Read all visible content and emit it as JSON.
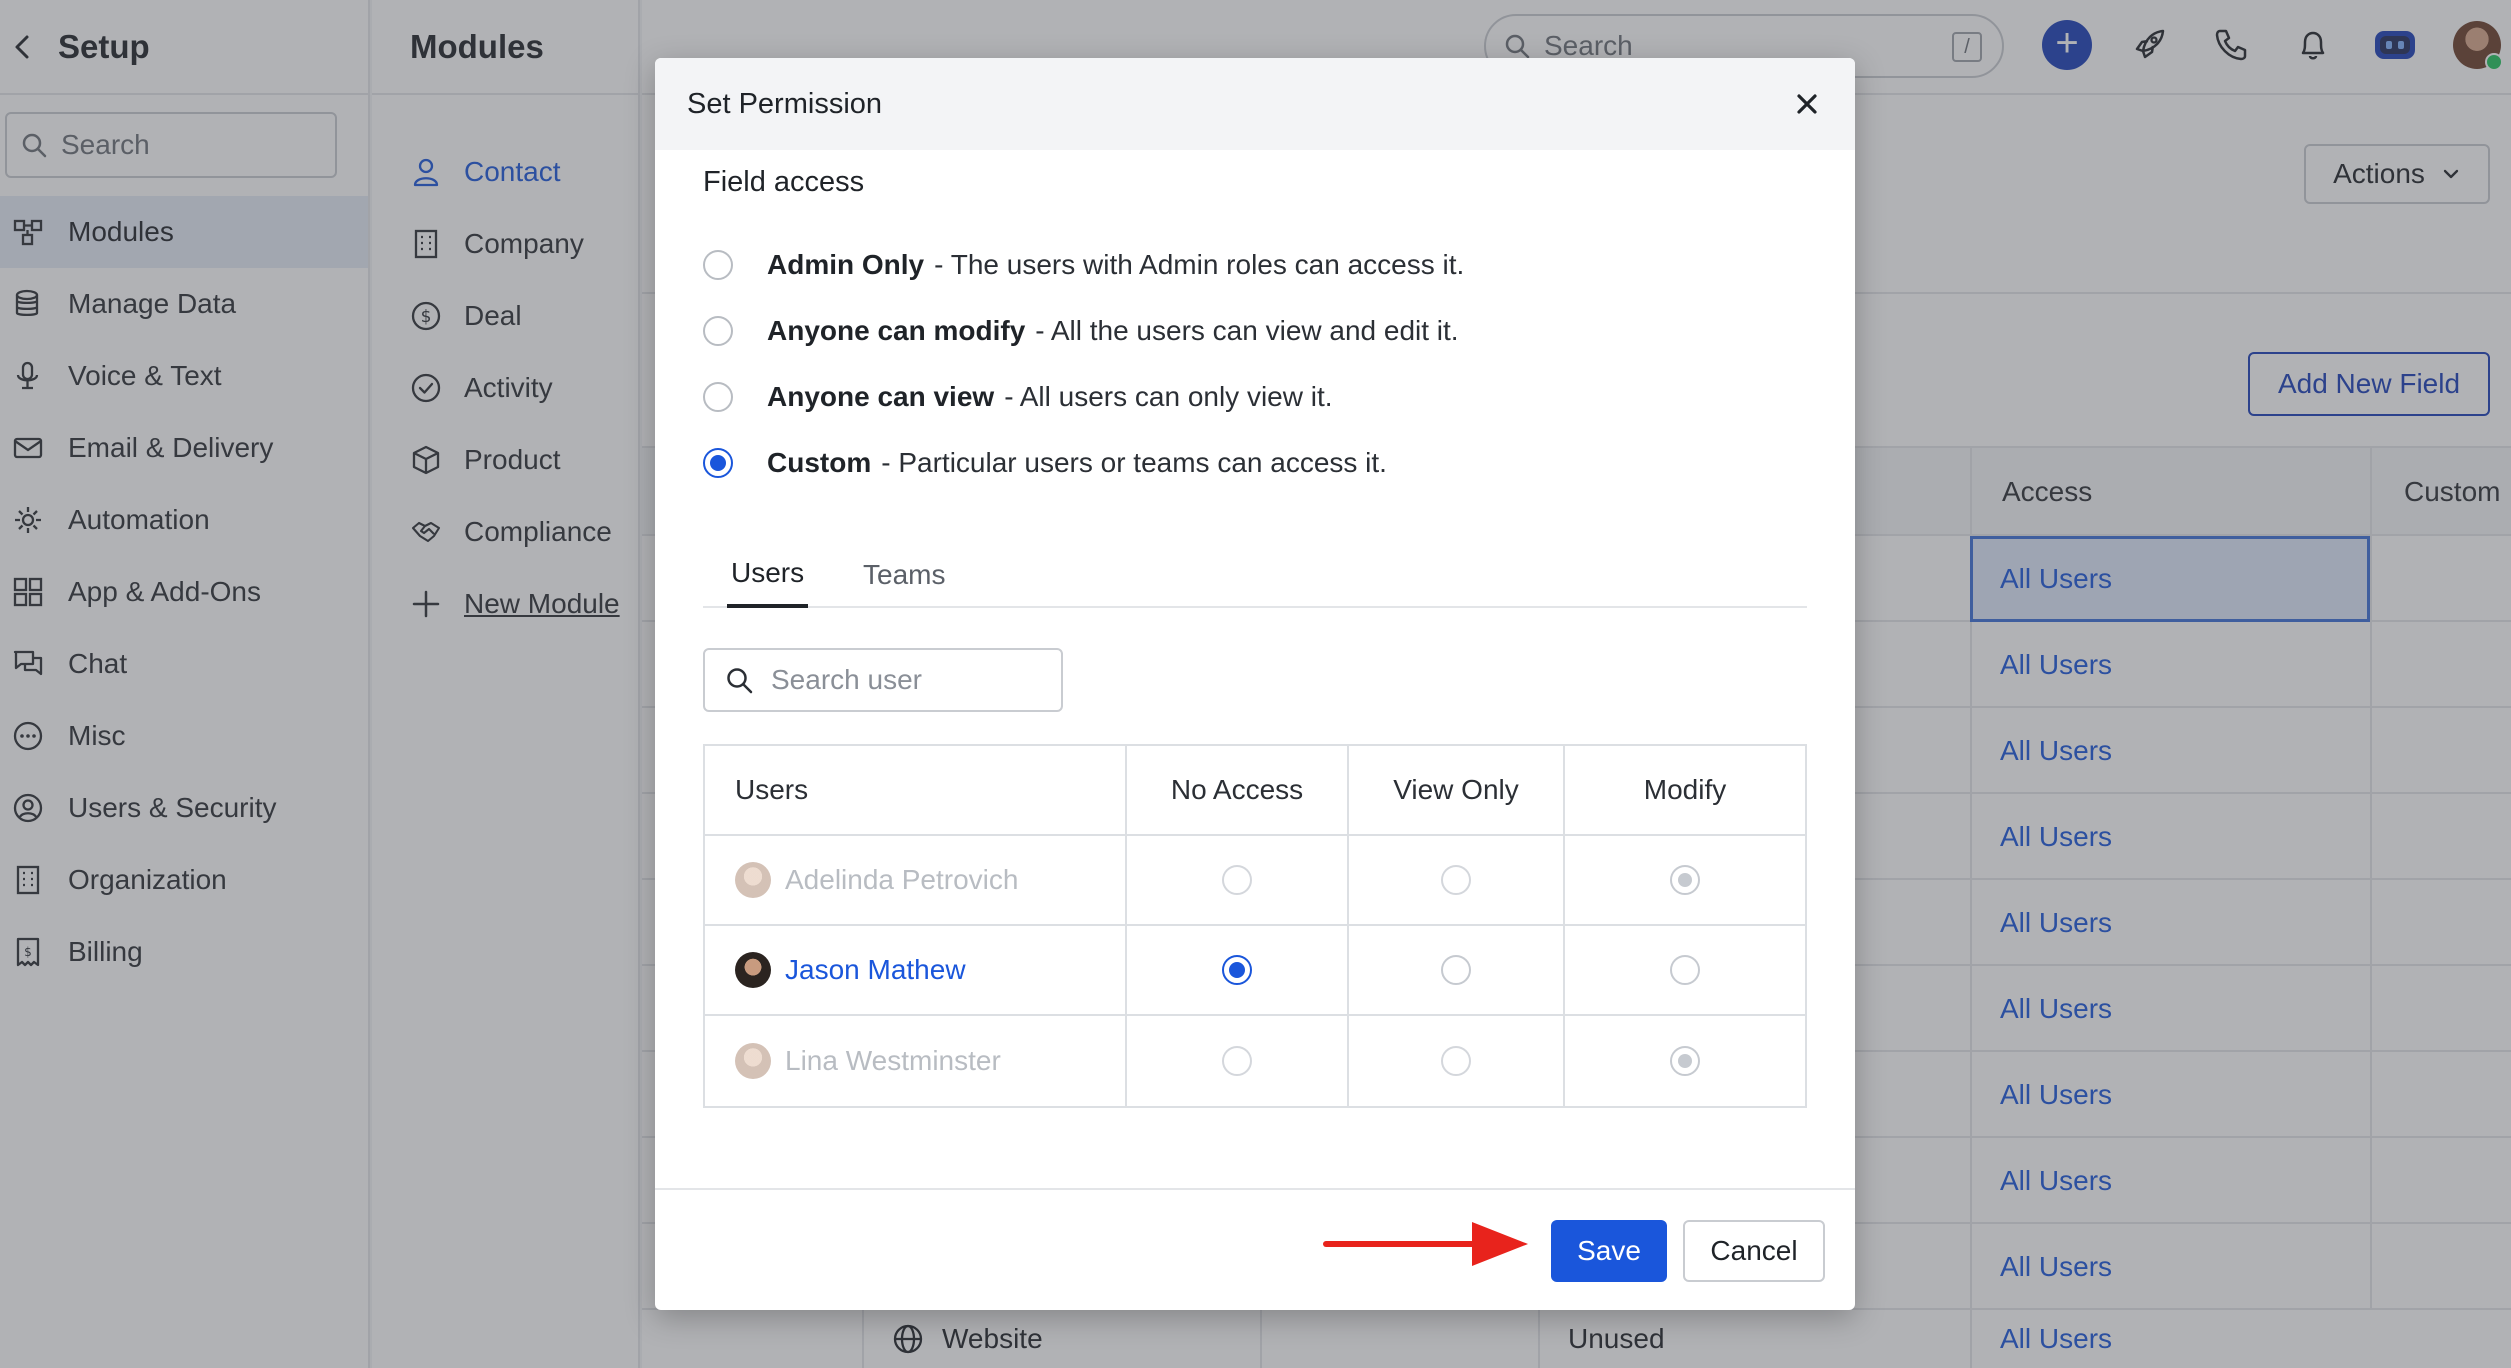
{
  "sidebar": {
    "title": "Setup",
    "search_placeholder": "Search",
    "items": [
      {
        "label": "Modules",
        "icon": "modules-icon",
        "active": true
      },
      {
        "label": "Manage Data",
        "icon": "database-icon"
      },
      {
        "label": "Voice & Text",
        "icon": "microphone-icon"
      },
      {
        "label": "Email & Delivery",
        "icon": "mail-icon"
      },
      {
        "label": "Automation",
        "icon": "automation-icon"
      },
      {
        "label": "App & Add-Ons",
        "icon": "apps-grid-icon"
      },
      {
        "label": "Chat",
        "icon": "chat-icon"
      },
      {
        "label": "Misc",
        "icon": "more-circle-icon"
      },
      {
        "label": "Users & Security",
        "icon": "user-circle-icon"
      },
      {
        "label": "Organization",
        "icon": "building-icon"
      },
      {
        "label": "Billing",
        "icon": "billing-icon"
      }
    ]
  },
  "modules": {
    "title": "Modules",
    "items": [
      {
        "label": "Contact",
        "icon": "person-icon",
        "active": true
      },
      {
        "label": "Company",
        "icon": "building-icon"
      },
      {
        "label": "Deal",
        "icon": "dollar-circle-icon"
      },
      {
        "label": "Activity",
        "icon": "check-circle-icon"
      },
      {
        "label": "Product",
        "icon": "box-icon"
      },
      {
        "label": "Compliance",
        "icon": "handshake-icon"
      },
      {
        "label": "New Module",
        "icon": "plus-icon",
        "link": true
      }
    ]
  },
  "topbar": {
    "search_placeholder": "Search",
    "search_shortcut": "/"
  },
  "main": {
    "actions_label": "Actions",
    "add_field_label": "Add New Field",
    "columns": {
      "access": "Access",
      "custom": "Custom"
    },
    "access_values": [
      "All Users",
      "All Users",
      "All Users",
      "All Users",
      "All Users",
      "All Users",
      "All Users",
      "All Users",
      "All Users"
    ],
    "bottom_row": {
      "module": "Website",
      "type": "Unused",
      "access": "All Users"
    }
  },
  "modal": {
    "title": "Set Permission",
    "section_title": "Field access",
    "options": [
      {
        "title": "Admin Only",
        "desc": "- The users with Admin roles can access it.",
        "selected": false
      },
      {
        "title": "Anyone can modify",
        "desc": "- All the users can view and edit it.",
        "selected": false
      },
      {
        "title": "Anyone can view",
        "desc": "- All users can only view it.",
        "selected": false
      },
      {
        "title": "Custom",
        "desc": "- Particular users or teams can access it.",
        "selected": true
      }
    ],
    "tabs": {
      "users": "Users",
      "teams": "Teams"
    },
    "user_search_placeholder": "Search user",
    "table": {
      "headers": {
        "user": "Users",
        "no_access": "No Access",
        "view_only": "View Only",
        "modify": "Modify"
      },
      "rows": [
        {
          "name": "Adelinda Petrovich",
          "selection": "modify",
          "enabled": false
        },
        {
          "name": "Jason Mathew",
          "selection": "no_access",
          "enabled": true
        },
        {
          "name": "Lina Westminster",
          "selection": "modify",
          "enabled": false
        }
      ]
    },
    "save_label": "Save",
    "cancel_label": "Cancel"
  },
  "colors": {
    "accent": "#1a56db",
    "annotation_arrow": "#e8231c"
  }
}
